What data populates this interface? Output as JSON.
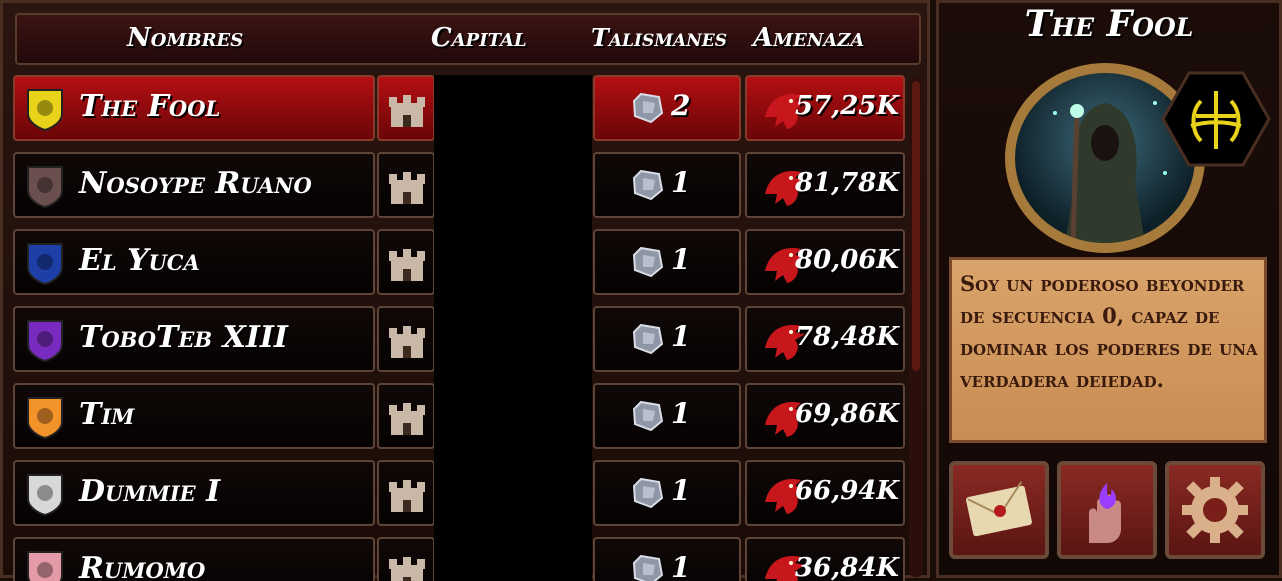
{
  "header": {
    "col_names": "Nombres",
    "col_capital": "Capital",
    "col_talismans": "Talismanes",
    "col_threat": "Amenaza"
  },
  "rows": [
    {
      "name": "The Fool",
      "talismans": "2",
      "threat": "57,25K",
      "emblem_icon": "yellow-sigil-icon",
      "emblem_color": "#e8d21a",
      "selected": true
    },
    {
      "name": "Nosoype Ruano",
      "talismans": "1",
      "threat": "81,78K",
      "emblem_icon": "winged-beast-icon",
      "emblem_color": "#6b4f4f"
    },
    {
      "name": "El Yuca",
      "talismans": "1",
      "threat": "80,06K",
      "emblem_icon": "ship-cross-icon",
      "emblem_color": "#1e3fa8"
    },
    {
      "name": "ToboTeb XIII",
      "talismans": "1",
      "threat": "78,48K",
      "emblem_icon": "purple-mask-icon",
      "emblem_color": "#7a2bbf"
    },
    {
      "name": "Tim",
      "talismans": "1",
      "threat": "69,86K",
      "emblem_icon": "dragon-shield-icon",
      "emblem_color": "#f2932a"
    },
    {
      "name": "Dummie I",
      "talismans": "1",
      "threat": "66,94K",
      "emblem_icon": "tree-shield-icon",
      "emblem_color": "#d8d8d8"
    },
    {
      "name": "Rumomo",
      "talismans": "1",
      "threat": "36,84K",
      "emblem_icon": "pink-emblem-icon",
      "emblem_color": "#e59aa8"
    }
  ],
  "profile": {
    "title": "The Fool",
    "quote": "Soy un poderoso beyonder de secuencia 0, capaz de dominar los poderes de una verdadera deiedad."
  },
  "colors": {
    "selected_row": "#b50f12",
    "parchment": "#d9a46b",
    "button_red": "#8a2a24"
  }
}
